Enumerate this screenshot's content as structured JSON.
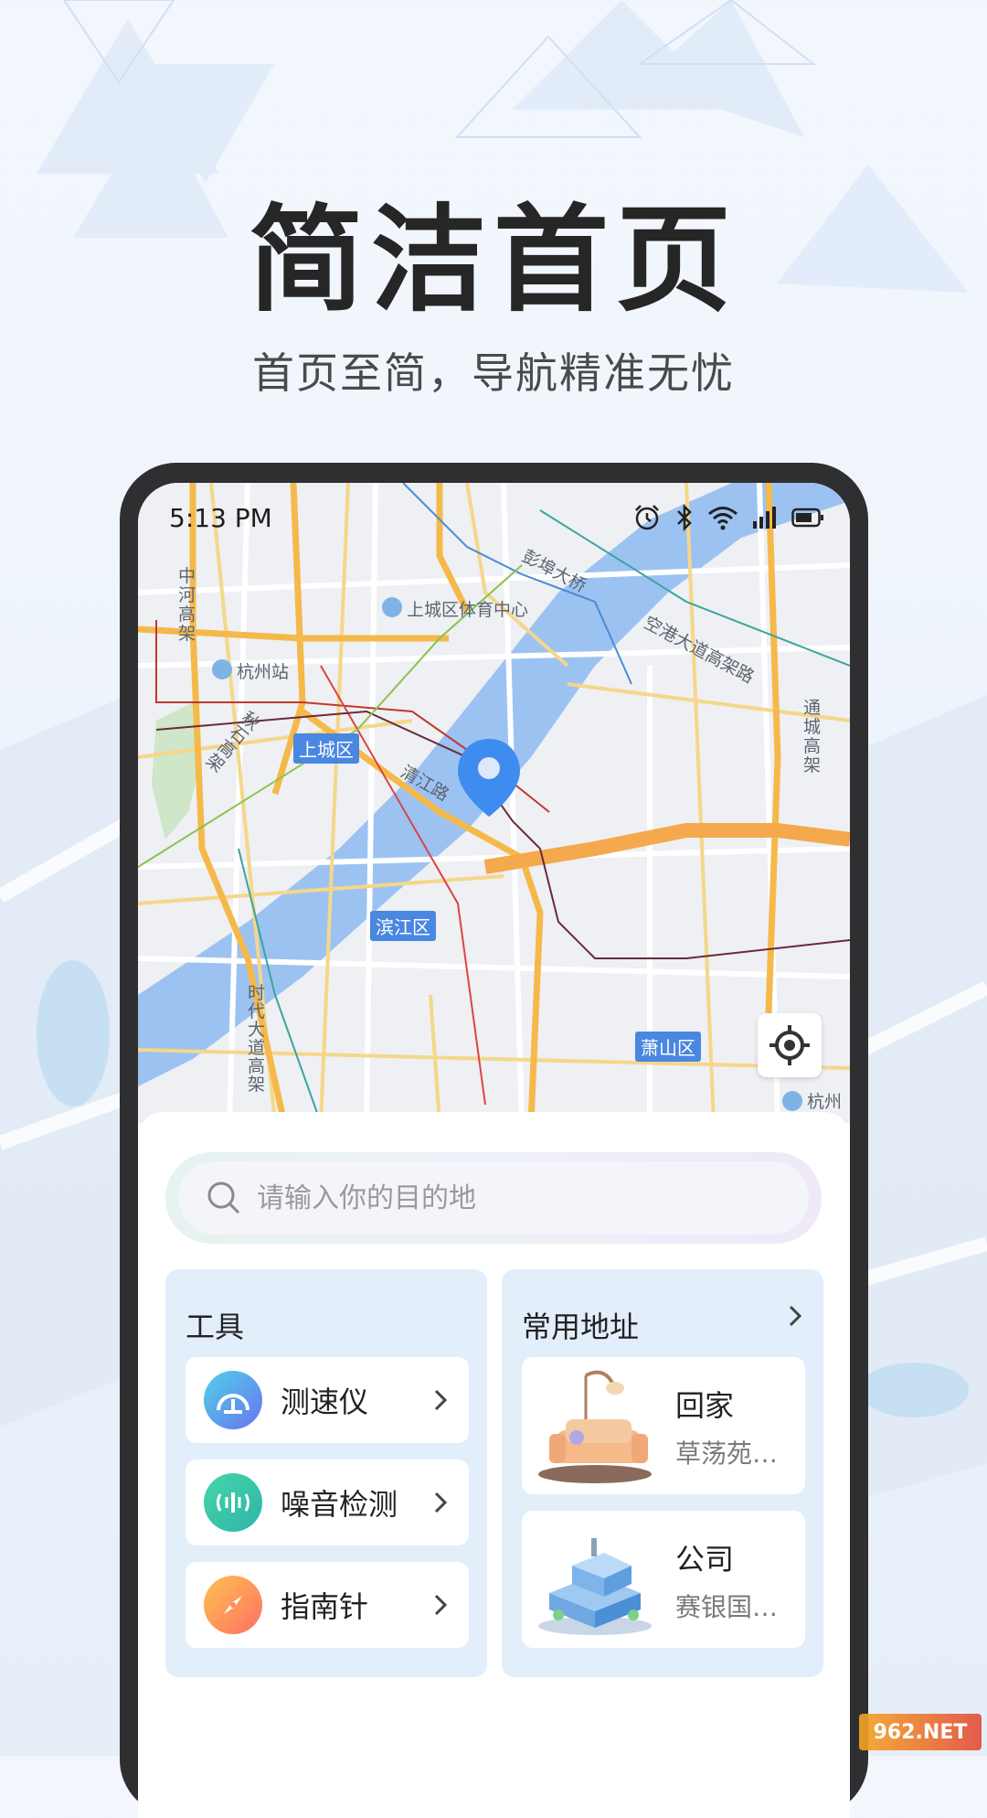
{
  "promo": {
    "headline": "简洁首页",
    "subline": "首页至简，导航精准无忧"
  },
  "status_bar": {
    "time": "5:13 PM",
    "icons": [
      "alarm-icon",
      "bluetooth-icon",
      "wifi-icon",
      "signal-icon",
      "battery-icon"
    ]
  },
  "map": {
    "labels": {
      "bridge": "彭埠大桥",
      "expressway": "空港大道高架路",
      "sports_center": "上城区体育中心",
      "station": "杭州站",
      "zhonghe": "中河高架",
      "qiushi": "秋石高架",
      "tongcheng": "通城高架",
      "qingjiang": "清江路",
      "shidai": "时代大道高架",
      "hang_partial": "杭州"
    },
    "districts": {
      "shangcheng": "上城区",
      "binjiang": "滨江区",
      "xiaoshan": "萧山区"
    }
  },
  "search": {
    "placeholder": "请输入你的目的地"
  },
  "tools": {
    "title": "工具",
    "items": [
      {
        "label": "测速仪",
        "icon": "speedometer-icon"
      },
      {
        "label": "噪音检测",
        "icon": "noise-icon"
      },
      {
        "label": "指南针",
        "icon": "compass-icon"
      }
    ]
  },
  "addresses": {
    "title": "常用地址",
    "items": [
      {
        "name": "回家",
        "detail": "草荡苑…",
        "icon": "home-illustration"
      },
      {
        "name": "公司",
        "detail": "赛银国…",
        "icon": "office-illustration"
      }
    ]
  },
  "watermark": "962.NET",
  "colors": {
    "accent": "#4a87e0",
    "card_bg": "#e3eefb",
    "river": "#9cc2f2",
    "road_main": "#f5b94a"
  }
}
